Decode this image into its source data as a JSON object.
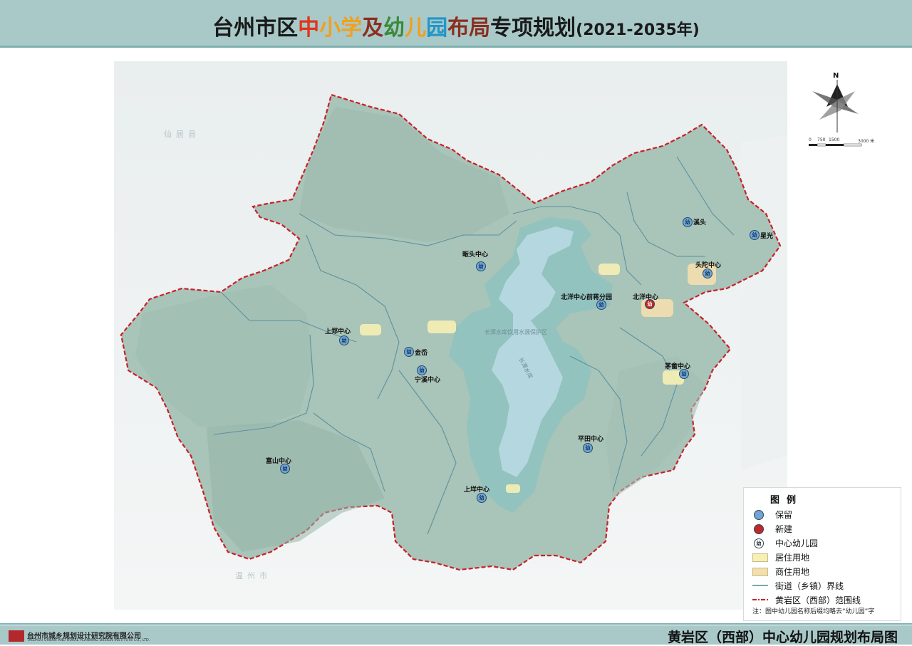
{
  "title": {
    "prefix": "台州市区",
    "c1": "中",
    "c2": "小",
    "c3": "学",
    "c4": "及",
    "c5": "幼",
    "c6": "儿",
    "c7": "园",
    "c8": "布",
    "c9": "局",
    "suffix": "专项规划",
    "years": "(2021-2035年)"
  },
  "compass": {
    "north_label": "N"
  },
  "scale": {
    "labels": [
      "0",
      "750",
      "1500",
      "3000 米"
    ]
  },
  "places": [
    {
      "id": "bantou",
      "label": "畈头中心",
      "status": "keep"
    },
    {
      "id": "shangzheng",
      "label": "上郑中心",
      "status": "keep"
    },
    {
      "id": "jinqi",
      "label": "金岙",
      "status": "keep"
    },
    {
      "id": "ningxi",
      "label": "宁溪中心",
      "status": "keep"
    },
    {
      "id": "beiyang-qianjiang",
      "label": "北洋中心前蒋分园",
      "status": "keep"
    },
    {
      "id": "beiyang",
      "label": "北洋中心",
      "status": "new"
    },
    {
      "id": "xitou",
      "label": "溪头",
      "status": "keep"
    },
    {
      "id": "xingguang",
      "label": "星光",
      "status": "keep"
    },
    {
      "id": "toutuo",
      "label": "头陀中心",
      "status": "keep"
    },
    {
      "id": "maoshe",
      "label": "茅畲中心",
      "status": "keep"
    },
    {
      "id": "pingtian",
      "label": "平田中心",
      "status": "keep"
    },
    {
      "id": "fushan",
      "label": "富山中心",
      "status": "keep"
    },
    {
      "id": "shangyang",
      "label": "上垟中心",
      "status": "keep"
    }
  ],
  "kg_glyph": "幼",
  "map_labels": {
    "reservoir_zone": "长潭水库饮用水源保护区",
    "reservoir": "长潭水库",
    "wenzhou": "温州市",
    "xianju": "仙居县"
  },
  "legend": {
    "title": "图例",
    "keep": "保留",
    "new": "新建",
    "center_kg": "中心幼儿园",
    "residential": "居住用地",
    "commercial_residential": "商住用地",
    "street_boundary": "街道（乡镇）界线",
    "district_boundary": "黄岩区（西部）范围线",
    "note": "注：图中幼儿园名称后缀均略去“幼儿园”字"
  },
  "colors": {
    "keep": "#6ea5d6",
    "new": "#c0272d",
    "residential": "#f6f0b4",
    "commercial_residential": "#f3dfae",
    "street_boundary": "#4f8a9a",
    "district_boundary": "#c8202a"
  },
  "footer": {
    "map_title": "黄岩区（西部）中心幼儿园规划布局图",
    "org_cn": "台州市城乡规划设计研究院有限公司",
    "org_en": "TAIZHOU URBAN AND RURAL PLANNING DESIGN INSTITUTE CO., LTD."
  }
}
